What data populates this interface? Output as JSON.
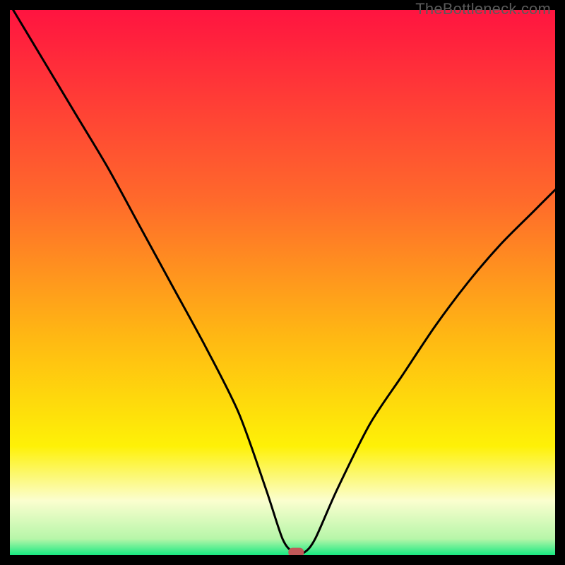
{
  "watermark": "TheBottleneck.com",
  "colors": {
    "gradient_top": "#ff1440",
    "gradient_mid1": "#ff6a2b",
    "gradient_mid2": "#ffb813",
    "gradient_mid3": "#fef107",
    "gradient_band": "#fbfecf",
    "gradient_bottom": "#17e981",
    "curve": "#000000",
    "marker": "#c15859",
    "frame": "#000000"
  },
  "chart_data": {
    "type": "line",
    "title": "",
    "xlabel": "",
    "ylabel": "",
    "xlim": [
      0,
      100
    ],
    "ylim": [
      0,
      100
    ],
    "grid": false,
    "legend": false,
    "series": [
      {
        "name": "bottleneck-curve",
        "x": [
          0,
          6,
          12,
          18,
          24,
          30,
          36,
          42,
          47,
          50,
          52,
          54,
          56,
          60,
          66,
          72,
          78,
          84,
          90,
          96,
          100
        ],
        "y": [
          101,
          91,
          81,
          71,
          60,
          49,
          38,
          26,
          12,
          3,
          0.5,
          0.5,
          3,
          12,
          24,
          33,
          42,
          50,
          57,
          63,
          67
        ]
      }
    ],
    "marker": {
      "x": 52.5,
      "y": 0.5,
      "name": "optimal-point"
    },
    "gradient_stops_percent": [
      {
        "pct": 0,
        "color": "#ff1440"
      },
      {
        "pct": 35,
        "color": "#ff6a2b"
      },
      {
        "pct": 60,
        "color": "#ffb813"
      },
      {
        "pct": 80,
        "color": "#fef107"
      },
      {
        "pct": 90,
        "color": "#fbfecf"
      },
      {
        "pct": 97,
        "color": "#b7f6a9"
      },
      {
        "pct": 100,
        "color": "#17e981"
      }
    ]
  }
}
